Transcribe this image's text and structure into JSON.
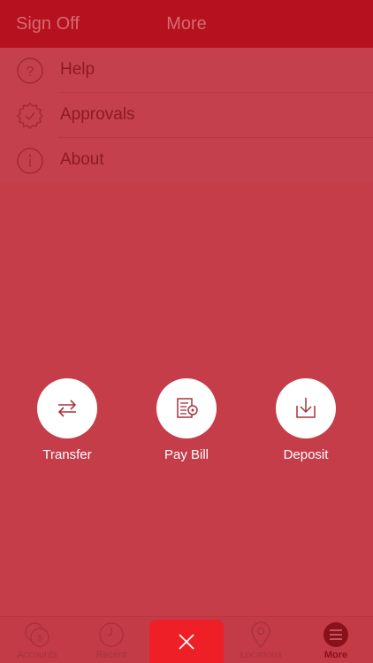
{
  "header": {
    "sign_off_label": "Sign Off",
    "title": "More"
  },
  "menu": {
    "items": [
      {
        "label": "Help",
        "icon": "help-icon"
      },
      {
        "label": "Approvals",
        "icon": "approval-badge-icon"
      },
      {
        "label": "About",
        "icon": "info-icon"
      }
    ]
  },
  "actions": [
    {
      "label": "Transfer",
      "icon": "transfer-arrows-icon"
    },
    {
      "label": "Pay Bill",
      "icon": "bill-icon"
    },
    {
      "label": "Deposit",
      "icon": "deposit-download-icon"
    }
  ],
  "tabbar": {
    "tabs": [
      {
        "label": "Accounts",
        "icon": "accounts-coins-icon"
      },
      {
        "label": "Recent",
        "icon": "clock-icon"
      },
      {
        "label": "",
        "icon": "close-icon"
      },
      {
        "label": "Locations",
        "icon": "location-pin-icon"
      },
      {
        "label": "More",
        "icon": "menu-lines-icon"
      }
    ],
    "active": "More"
  },
  "colors": {
    "overlay": "#c43d49",
    "header": "#b5111f",
    "close_button": "#ee1f26",
    "dark_text": "#8e1a24"
  }
}
